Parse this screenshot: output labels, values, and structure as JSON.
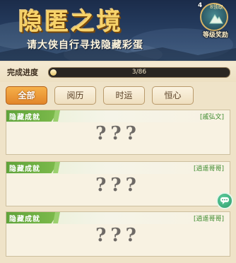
{
  "banner": {
    "title": "隐匿之境",
    "subtitle": "请大侠自行寻找隐藏彩蛋",
    "reward": {
      "count": "4",
      "tag": "8领取",
      "label": "等级奖励"
    }
  },
  "progress": {
    "label": "完成进度",
    "current": 3,
    "total": 86,
    "text": "3/86"
  },
  "tabs": [
    {
      "label": "全部",
      "active": true
    },
    {
      "label": "阅历",
      "active": false
    },
    {
      "label": "时运",
      "active": false
    },
    {
      "label": "恒心",
      "active": false
    }
  ],
  "cards": [
    {
      "tag": "隐藏成就",
      "name": "[戚弘文]",
      "text": "???"
    },
    {
      "tag": "隐藏成就",
      "name": "[逍遥哥哥]",
      "text": "???"
    },
    {
      "tag": "隐藏成就",
      "name": "[逍遥哥哥]",
      "text": "???"
    }
  ],
  "colors": {
    "active_tab": "#e98f2e",
    "tag_green": "#5fa33a",
    "name_green": "#3c8a2d"
  }
}
